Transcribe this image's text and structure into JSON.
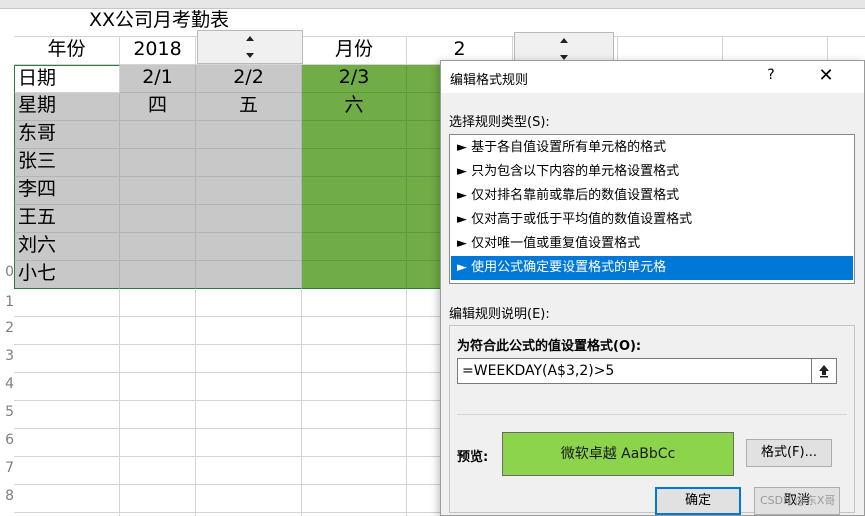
{
  "sheet": {
    "title": "XX公司月考勤表",
    "year_label": "年份",
    "year_value": "2018",
    "month_label": "月份",
    "month_value": "2",
    "date_label": "日期",
    "weekday_label": "星期",
    "dates": [
      "2/1",
      "2/2",
      "2/3"
    ],
    "weekdays": [
      "四",
      "五",
      "六"
    ],
    "names": [
      "东哥",
      "张三",
      "李四",
      "王五",
      "刘六",
      "小七"
    ],
    "row_numbers": [
      "0",
      "1",
      "2",
      "3",
      "4",
      "5",
      "6",
      "7",
      "8"
    ],
    "colors": {
      "gray": "#c8c8c8",
      "green": "#70ad47"
    }
  },
  "dialog": {
    "title": "编辑格式规则",
    "help": "?",
    "close": "✕",
    "select_type_label": "选择规则类型(S):",
    "rules": [
      "► 基于各自值设置所有单元格的格式",
      "► 只为包含以下内容的单元格设置格式",
      "► 仅对排名靠前或靠后的数值设置格式",
      "► 仅对高于或低于平均值的数值设置格式",
      "► 仅对唯一值或重复值设置格式",
      "► 使用公式确定要设置格式的单元格"
    ],
    "selected_rule_index": 5,
    "edit_desc_label": "编辑规则说明(E):",
    "formula_caption": "为符合此公式的值设置格式(O):",
    "formula_value": "=WEEKDAY(A$3,2)>5",
    "preview_label": "预览:",
    "preview_text": "微软卓越  AaBbCc",
    "preview_color": "#8cd44b",
    "format_button": "格式(F)...",
    "ok_button": "确定",
    "cancel_button": "取消"
  },
  "watermark": "CSDN @东X哥"
}
